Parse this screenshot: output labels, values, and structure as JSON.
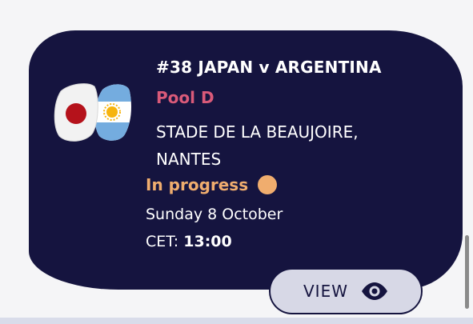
{
  "match": {
    "title": "#38 JAPAN v ARGENTINA",
    "pool": "Pool D",
    "stadium": "STADE DE LA BEAUJOIRE, NANTES",
    "status": "In progress",
    "date": "Sunday 8 October",
    "time_label": "CET:",
    "time_value": "13:00"
  },
  "flags": {
    "home_icon": "japan-flag-icon",
    "away_icon": "argentina-flag-icon"
  },
  "actions": {
    "view_label": "VIEW",
    "view_icon": "eye-icon"
  },
  "colors": {
    "card_background": "#15143f",
    "pool_text": "#d95a79",
    "status_accent": "#f0ad6e",
    "button_background": "#d7d8e6"
  }
}
